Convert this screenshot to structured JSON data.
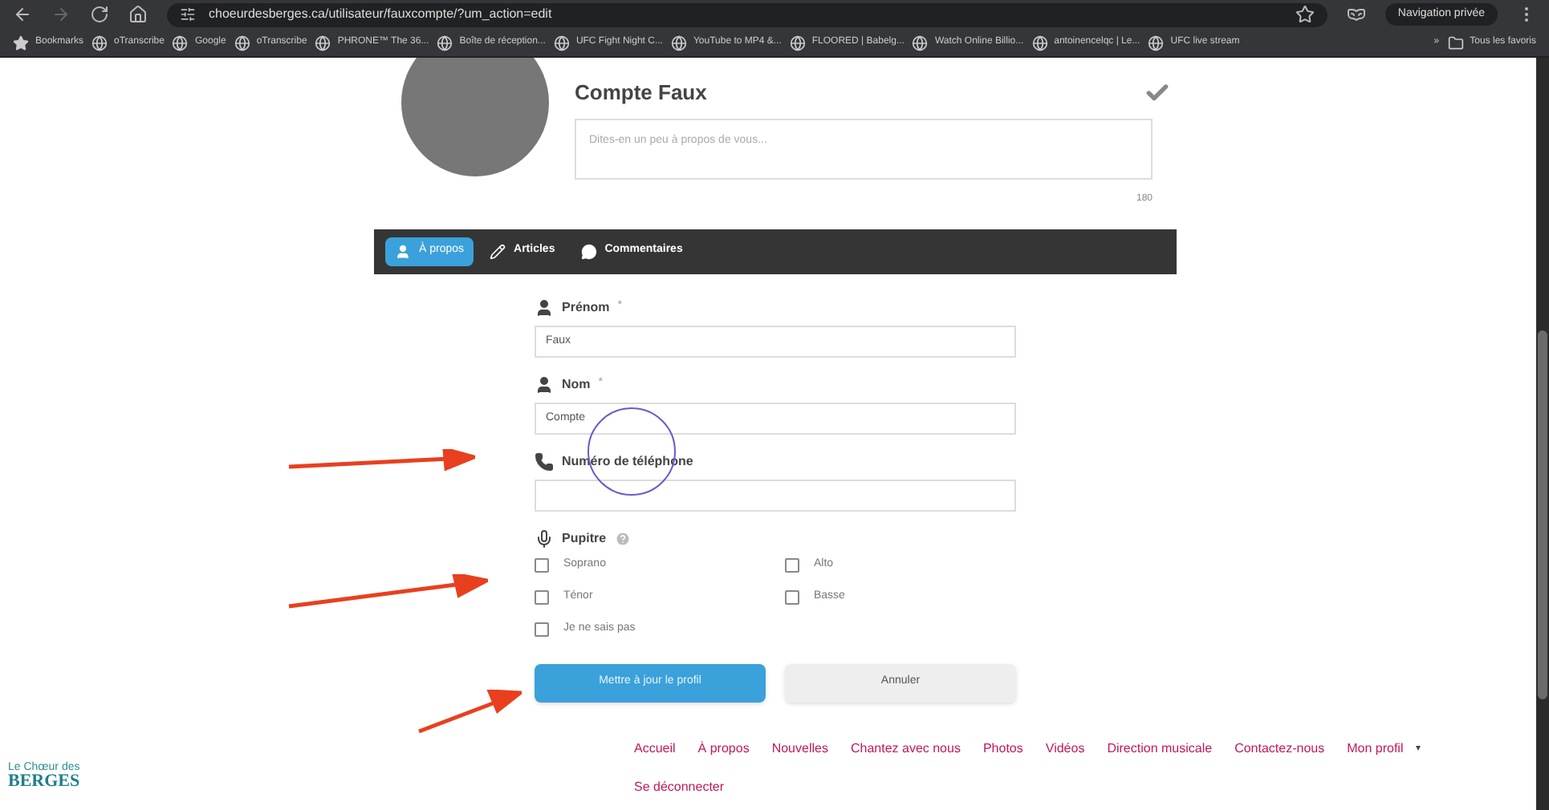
{
  "browser": {
    "url": "choeurdesberges.ca/utilisateur/fauxcompte/?um_action=edit",
    "private_label": "Navigation privée",
    "bookmarks": [
      "Bookmarks",
      "oTranscribe",
      "Google",
      "oTranscribe",
      "PHRONE™ The 36...",
      "Boîte de réception...",
      "UFC Fight Night C...",
      "YouTube to MP4 &...",
      "FLOORED | Babelg...",
      "Watch Online Billio...",
      "antoinencelqc | Le...",
      "UFC live stream"
    ],
    "more": "»",
    "all_favorites": "Tous les favoris"
  },
  "profile": {
    "name": "Compte Faux",
    "bio_placeholder": "Dites-en un peu à propos de vous...",
    "char_count": "180"
  },
  "tabs": [
    {
      "label": "À propos",
      "selected": true
    },
    {
      "label": "Articles",
      "selected": false
    },
    {
      "label": "Commentaires",
      "selected": false
    }
  ],
  "fields": [
    {
      "label": "Prénom",
      "kind": "person",
      "required_mark": "*",
      "value": "Faux"
    },
    {
      "label": "Nom",
      "kind": "person",
      "required_mark": "*",
      "value": "Compte"
    },
    {
      "label": "Numéro de téléphone",
      "kind": "phone"
    }
  ],
  "pupitre": {
    "label": "Pupitre",
    "options": [
      {
        "label": "Soprano",
        "checked": false
      },
      {
        "label": "Alto",
        "checked": false
      },
      {
        "label": "Ténor",
        "checked": false
      },
      {
        "label": "Basse",
        "checked": false
      },
      {
        "label": "Je ne sais pas",
        "checked": false
      }
    ]
  },
  "buttons": [
    {
      "label": "Mettre à jour le profil",
      "kind": "primary"
    },
    {
      "label": "Annuler",
      "kind": "secondary"
    }
  ],
  "footer": {
    "logo_top": "Le Chœur des",
    "logo_bottom": "BERGES",
    "nav": [
      "Accueil",
      "À propos",
      "Nouvelles",
      "Chantez avec nous",
      "Photos",
      "Vidéos",
      "Direction musicale",
      "Contactez-nous",
      "Mon profil",
      "Se déconnecter"
    ],
    "nav_caret": "▾"
  }
}
